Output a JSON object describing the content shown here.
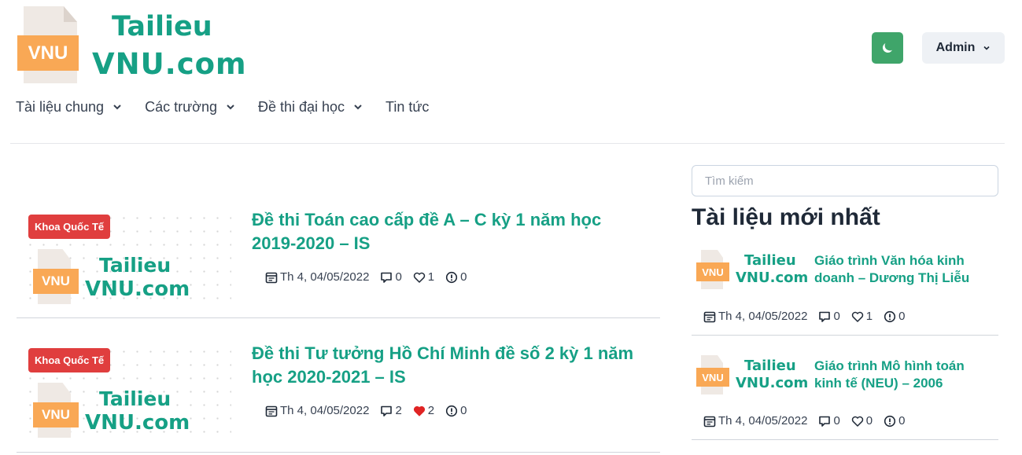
{
  "brand": {
    "line1": "Tailieu",
    "line2": "VNU.com",
    "badge": "VNU",
    "color": "#16a085",
    "accent": "#f9a855"
  },
  "header": {
    "theme_icon": "moon-icon",
    "user_label": "Admin",
    "user_icon": "chevron-down-icon"
  },
  "nav": [
    {
      "label": "Tài liệu chung",
      "has_dropdown": true
    },
    {
      "label": "Các trường",
      "has_dropdown": true
    },
    {
      "label": "Đề thi đại học",
      "has_dropdown": true
    },
    {
      "label": "Tin tức",
      "has_dropdown": false
    }
  ],
  "posts": [
    {
      "badge": "Khoa Quốc Tế",
      "title": "Đề thi Toán cao cấp đề A – C kỳ 1 năm học 2019-2020 – IS",
      "date": "Th 4, 04/05/2022",
      "comments": "0",
      "likes": "1",
      "liked": false,
      "reports": "0"
    },
    {
      "badge": "Khoa Quốc Tế",
      "title": "Đề thi Tư tưởng Hồ Chí Minh đề số 2 kỳ 1 năm học 2020-2021 – IS",
      "date": "Th 4, 04/05/2022",
      "comments": "2",
      "likes": "2",
      "liked": true,
      "reports": "0"
    }
  ],
  "sidebar": {
    "search_placeholder": "Tìm kiếm",
    "title": "Tài liệu mới nhất",
    "items": [
      {
        "title": "Giáo trình Văn hóa kinh doanh – Dương Thị Liễu",
        "date": "Th 4, 04/05/2022",
        "comments": "0",
        "likes": "1",
        "reports": "0"
      },
      {
        "title": "Giáo trình Mô hình toán kinh tế (NEU) – 2006",
        "date": "Th 4, 04/05/2022",
        "comments": "0",
        "likes": "0",
        "reports": "0"
      }
    ]
  },
  "colors": {
    "green_button": "#3fa56a",
    "badge_red": "#e03e3e",
    "heart_red": "#e02424"
  }
}
